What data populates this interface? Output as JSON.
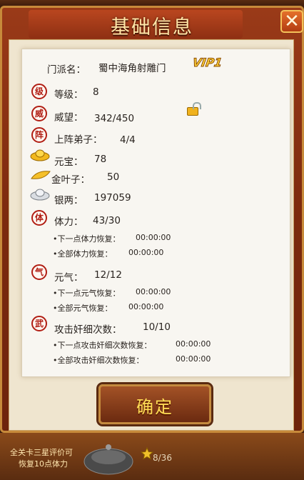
{
  "title": "基础信息",
  "close_label": "✕",
  "sect": {
    "label": "门派名：",
    "value": "蜀中海角射雕门",
    "vip": "VIP1"
  },
  "rows": {
    "level": {
      "seal": "级",
      "label": "等级：",
      "value": "8"
    },
    "prestige": {
      "seal": "威",
      "label": "威望：",
      "value": "342/450"
    },
    "disciples": {
      "seal": "阵",
      "label": "上阵弟子：",
      "value": "4/4"
    },
    "yuanbao": {
      "label": "元宝：",
      "value": "78"
    },
    "goldleaf": {
      "label": "金叶子：",
      "value": "50"
    },
    "silver": {
      "label": "银两：",
      "value": "197059"
    },
    "stamina": {
      "seal": "体",
      "label": "体力：",
      "value": "43/30",
      "next_label": "•下一点体力恢复：",
      "next_value": "00:00:00",
      "all_label": "•全部体力恢复：",
      "all_value": "00:00:00"
    },
    "vigor": {
      "seal": "气",
      "label": "元气：",
      "value": "12/12",
      "next_label": "•下一点元气恢复：",
      "next_value": "00:00:00",
      "all_label": "•全部元气恢复：",
      "all_value": "00:00:00"
    },
    "attack": {
      "seal": "武",
      "label": "攻击奸细次数：",
      "value": "10/10",
      "next_label": "•下一点攻击奸细次数恢复：",
      "next_value": "00:00:00",
      "all_label": "•全部攻击奸细次数恢复：",
      "all_value": "00:00:00"
    }
  },
  "confirm_label": "确定",
  "bottom": {
    "line1": "全关卡三星评价可",
    "line2": "恢复10点体力",
    "progress": "8/36"
  },
  "colors": {
    "seal": "#b11e14",
    "frame": "#7c2a0e",
    "card": "#f8f6f1",
    "button_text": "#ffdd55"
  }
}
